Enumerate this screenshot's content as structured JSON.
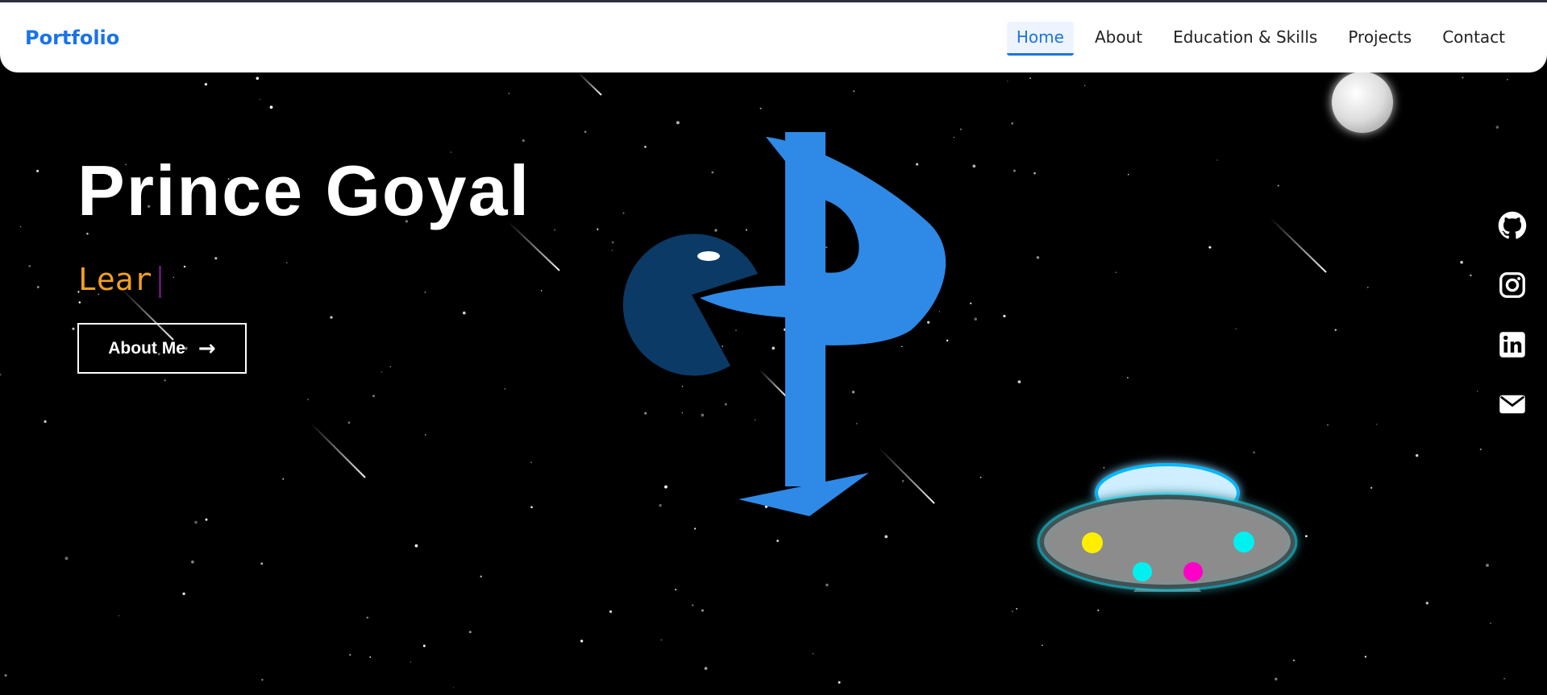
{
  "brand": {
    "label": "Portfolio"
  },
  "nav": {
    "items": [
      {
        "label": "Home",
        "active": true
      },
      {
        "label": "About",
        "active": false
      },
      {
        "label": "Education & Skills",
        "active": false
      },
      {
        "label": "Projects",
        "active": false
      },
      {
        "label": "Contact",
        "active": false
      }
    ]
  },
  "hero": {
    "name": "Prince Goyal",
    "typed_text": "Lear",
    "cta_label": "About Me",
    "cta_arrow": "→"
  },
  "socials": [
    {
      "name": "github",
      "icon": "github-icon"
    },
    {
      "name": "instagram",
      "icon": "instagram-icon"
    },
    {
      "name": "linkedin",
      "icon": "linkedin-icon"
    },
    {
      "name": "email",
      "icon": "envelope-icon"
    }
  ],
  "colors": {
    "accent": "#1a73e8",
    "typed": "#f0a020",
    "logo_blue": "#2e8ae6",
    "pacman": "#0b3a66",
    "ufo_glow": "#00e5ff"
  }
}
